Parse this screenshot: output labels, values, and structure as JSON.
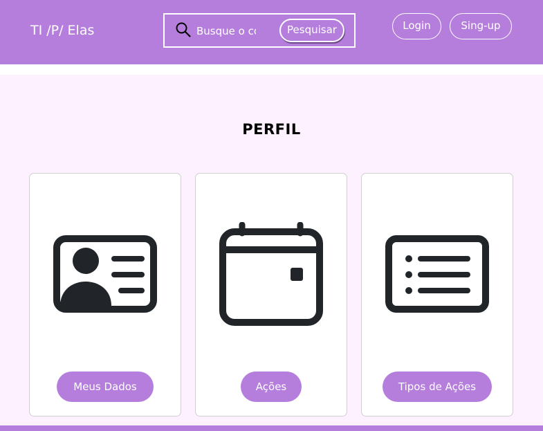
{
  "navbar": {
    "brand": "TI /P/ Elas",
    "search": {
      "placeholder": "Busque o conteúdo",
      "button_label": "Pesquisar"
    },
    "login_label": "Login",
    "signup_label": "Sing-up"
  },
  "main": {
    "title": "PERFIL",
    "cards": [
      {
        "icon": "person-badge-icon",
        "button_label": "Meus Dados"
      },
      {
        "icon": "calendar-icon",
        "button_label": "Ações"
      },
      {
        "icon": "list-card-icon",
        "button_label": "Tipos de Ações"
      }
    ]
  },
  "colors": {
    "accent": "#b57edc",
    "page_background": "#fdf0ff",
    "icon": "#212529"
  }
}
